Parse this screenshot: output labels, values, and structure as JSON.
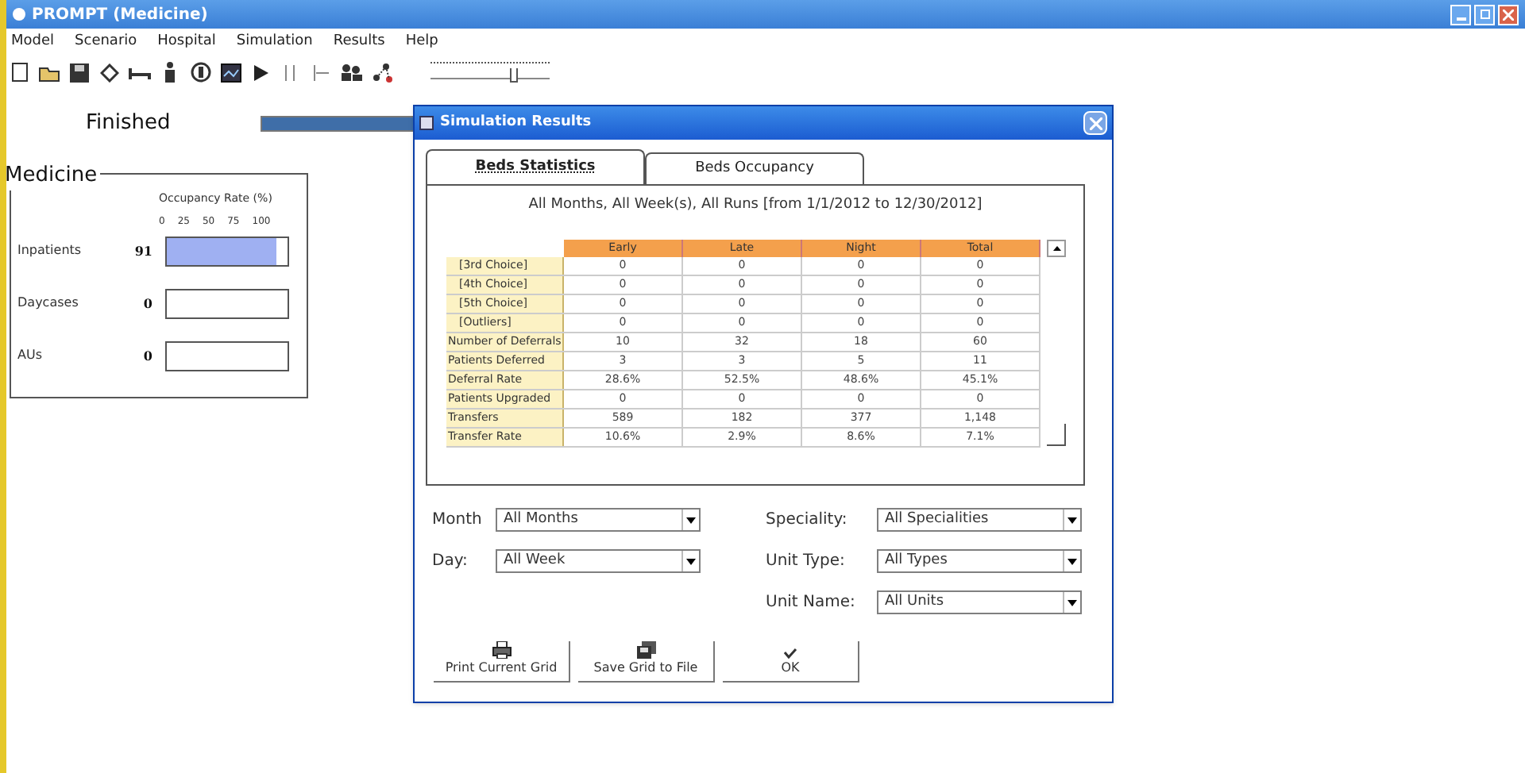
{
  "window": {
    "title": "PROMPT (Medicine)"
  },
  "menu": [
    "Model",
    "Scenario",
    "Hospital",
    "Simulation",
    "Results",
    "Help"
  ],
  "toolbar": {
    "slider": {
      "level": 0.72
    }
  },
  "status": {
    "text": "Finished",
    "level": 1
  },
  "group": {
    "title": "Medicine",
    "scale_title": "Occupancy Rate (%)",
    "ticks": [
      "0",
      "25",
      "50",
      "75",
      "100"
    ],
    "rows": [
      {
        "name": "Inpatients",
        "value": "91",
        "level": 0.91
      },
      {
        "name": "Daycases",
        "value": "0",
        "level": 0
      },
      {
        "name": "AUs",
        "value": "0",
        "level": 0
      }
    ]
  },
  "dialog": {
    "title": "Simulation Results",
    "tabs": [
      {
        "label": "Beds Statistics",
        "selected": true
      },
      {
        "label": "Beds Occupancy",
        "selected": false
      }
    ],
    "subtitle": "All Months, All Week(s), All Runs [from 1/1/2012 to 12/30/2012]",
    "table": {
      "columns": [
        "Early",
        "Late",
        "Night",
        "Total"
      ],
      "rows": [
        {
          "label": "[3rd Choice]",
          "indent": true,
          "cells": [
            "0",
            "0",
            "0",
            "0"
          ]
        },
        {
          "label": "[4th Choice]",
          "indent": true,
          "cells": [
            "0",
            "0",
            "0",
            "0"
          ]
        },
        {
          "label": "[5th Choice]",
          "indent": true,
          "cells": [
            "0",
            "0",
            "0",
            "0"
          ]
        },
        {
          "label": "[Outliers]",
          "indent": true,
          "cells": [
            "0",
            "0",
            "0",
            "0"
          ]
        },
        {
          "label": "Number of Deferrals",
          "indent": false,
          "cells": [
            "10",
            "32",
            "18",
            "60"
          ]
        },
        {
          "label": "Patients Deferred",
          "indent": false,
          "cells": [
            "3",
            "3",
            "5",
            "11"
          ]
        },
        {
          "label": "Deferral Rate",
          "indent": false,
          "cells": [
            "28.6%",
            "52.5%",
            "48.6%",
            "45.1%"
          ]
        },
        {
          "label": "Patients Upgraded",
          "indent": false,
          "cells": [
            "0",
            "0",
            "0",
            "0"
          ]
        },
        {
          "label": "Transfers",
          "indent": false,
          "cells": [
            "589",
            "182",
            "377",
            "1,148"
          ]
        },
        {
          "label": "Transfer Rate",
          "indent": false,
          "cells": [
            "10.6%",
            "2.9%",
            "8.6%",
            "7.1%"
          ]
        }
      ]
    },
    "filters_left": [
      {
        "label": "Month",
        "value": "All Months"
      },
      {
        "label": "Day:",
        "value": "All Week"
      }
    ],
    "filters_right": [
      {
        "label": "Speciality:",
        "value": "All Specialities"
      },
      {
        "label": "Unit Type:",
        "value": "All Types"
      },
      {
        "label": "Unit Name:",
        "value": "All Units"
      }
    ],
    "buttons": [
      {
        "kind": "print",
        "label": "Print Current Grid"
      },
      {
        "kind": "save",
        "label": "Save Grid to File"
      },
      {
        "kind": "ok",
        "label": "OK"
      }
    ]
  }
}
